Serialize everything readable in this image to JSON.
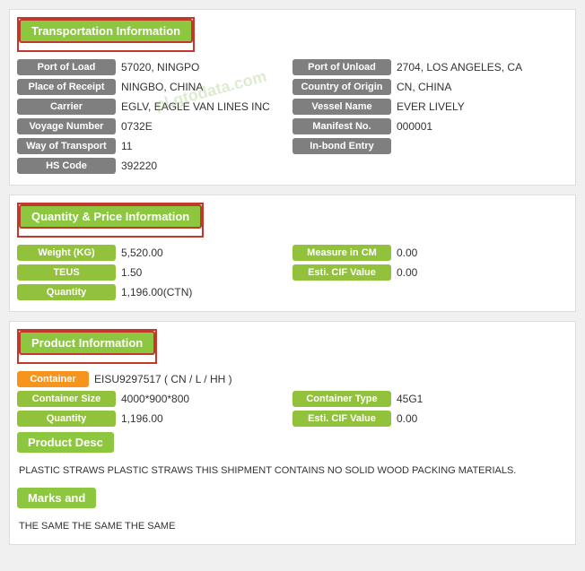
{
  "transport_section": {
    "header": "Transportation Information",
    "fields": [
      {
        "left_label": "Port of Load",
        "left_value": "57020, NINGPO",
        "right_label": "Port of Unload",
        "right_value": "2704, LOS ANGELES, CA"
      },
      {
        "left_label": "Place of Receipt",
        "left_value": "NINGBO, CHINA",
        "right_label": "Country of Origin",
        "right_value": "CN, CHINA"
      },
      {
        "left_label": "Carrier",
        "left_value": "EGLV, EAGLE VAN LINES INC",
        "right_label": "Vessel Name",
        "right_value": "EVER LIVELY"
      },
      {
        "left_label": "Voyage Number",
        "left_value": "0732E",
        "right_label": "Manifest No.",
        "right_value": "000001"
      },
      {
        "left_label": "Way of Transport",
        "left_value": "11",
        "right_label": "In-bond Entry",
        "right_value": ""
      },
      {
        "left_label": "HS Code",
        "left_value": "392220",
        "right_label": "",
        "right_value": ""
      }
    ]
  },
  "quantity_section": {
    "header": "Quantity & Price Information",
    "fields": [
      {
        "left_label": "Weight (KG)",
        "left_value": "5,520.00",
        "right_label": "Measure in CM",
        "right_value": "0.00"
      },
      {
        "left_label": "TEUS",
        "left_value": "1.50",
        "right_label": "Esti. CIF Value",
        "right_value": "0.00"
      },
      {
        "left_label": "Quantity",
        "left_value": "1,196.00(CTN)",
        "right_label": "",
        "right_value": ""
      }
    ]
  },
  "product_section": {
    "header": "Product Information",
    "container_label": "Container",
    "container_value": "EISU9297517 ( CN / L / HH )",
    "fields": [
      {
        "left_label": "Container Size",
        "left_value": "4000*900*800",
        "right_label": "Container Type",
        "right_value": "45G1"
      },
      {
        "left_label": "Quantity",
        "left_value": "1,196.00",
        "right_label": "Esti. CIF Value",
        "right_value": "0.00"
      }
    ],
    "product_desc_label": "Product Desc",
    "product_desc_text": "PLASTIC STRAWS PLASTIC STRAWS THIS SHIPMENT CONTAINS NO SOLID WOOD PACKING MATERIALS.",
    "marks_label": "Marks and",
    "marks_text": "THE SAME THE SAME THE SAME"
  },
  "watermark": "pl.gtodata.com"
}
